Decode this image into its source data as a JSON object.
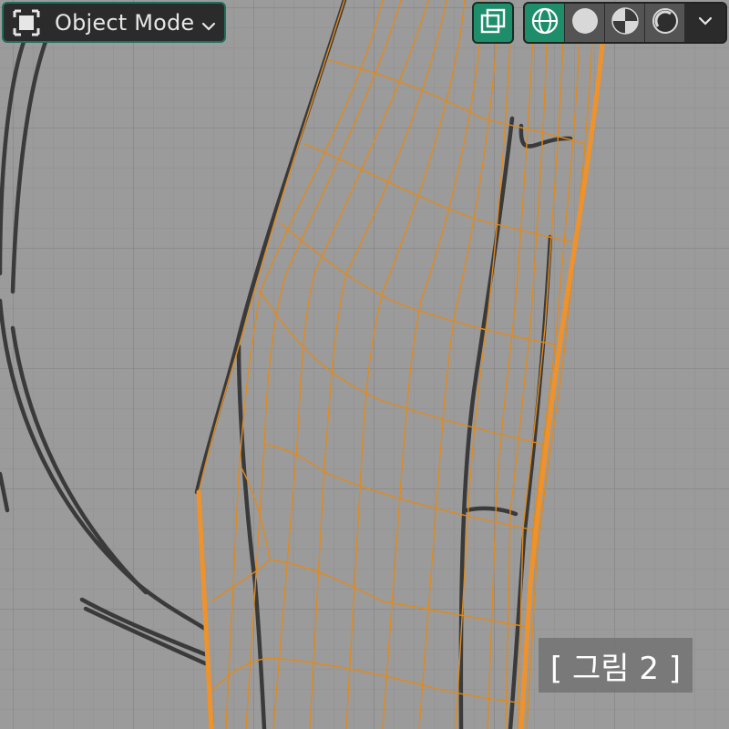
{
  "header": {
    "mode_label": "Object Mode",
    "mode_icon": "object-mode-icon",
    "mode_dropdown_icon": "chevron-down-icon"
  },
  "toolbar": {
    "xray_icon": "xray-toggle-icon",
    "shading_buttons": [
      {
        "name": "wireframe-shading",
        "icon": "wireframe-sphere-icon",
        "active": true
      },
      {
        "name": "solid-shading",
        "icon": "solid-sphere-icon",
        "active": false
      },
      {
        "name": "material-preview-shading",
        "icon": "material-sphere-icon",
        "active": false
      },
      {
        "name": "rendered-shading",
        "icon": "rendered-sphere-icon",
        "active": false
      }
    ],
    "dropdown_icon": "chevron-down-icon"
  },
  "viewport": {
    "caption": "[ 그림 2 ]"
  },
  "colors": {
    "accent": "#1e8e6a",
    "wire": "#e08a1e",
    "background": "#9a9a9a",
    "grid": "#8c8c8c"
  }
}
